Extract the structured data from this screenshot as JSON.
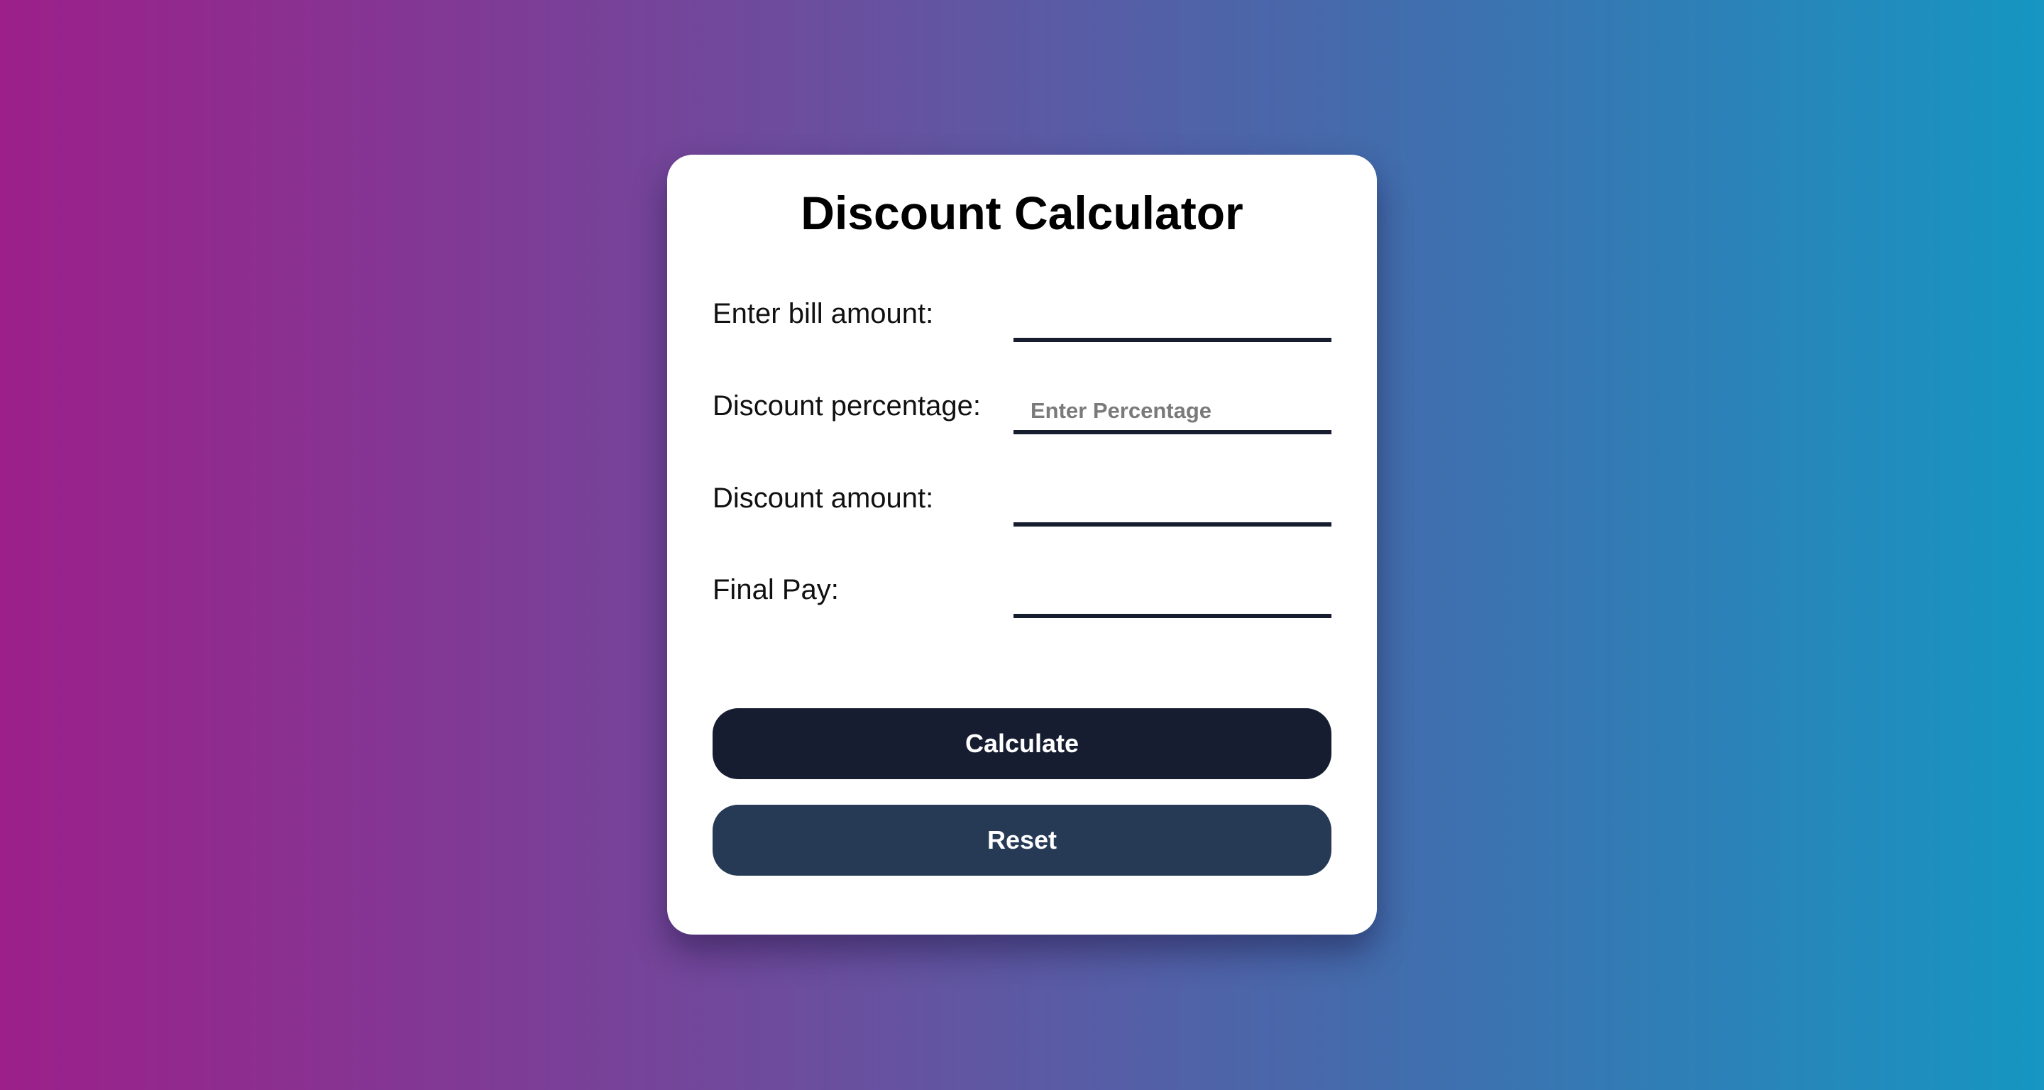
{
  "calculator": {
    "title": "Discount Calculator",
    "bill_label": "Enter bill amount:",
    "bill_value": "",
    "percentage_label": "Discount percentage:",
    "percentage_placeholder": "Enter Percentage",
    "percentage_value": "",
    "discount_label": "Discount amount:",
    "discount_value": "",
    "final_label": "Final Pay:",
    "final_value": "",
    "calculate_label": "Calculate",
    "reset_label": "Reset"
  },
  "colors": {
    "gradient_start": "#9c1f8a",
    "gradient_end": "#1696c2",
    "primary_button": "#161d30",
    "secondary_button": "#263a56",
    "underline": "#161d2e"
  }
}
